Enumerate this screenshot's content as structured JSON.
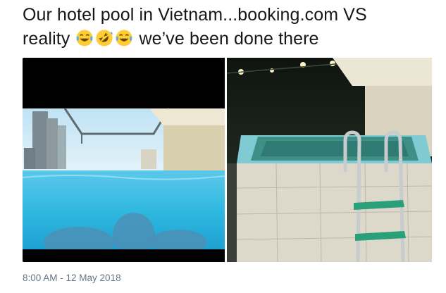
{
  "tweet": {
    "text_line1": "Our hotel pool in Vietnam...booking.com VS",
    "text_line2_before": "reality",
    "text_line2_after": "we’ve been done there",
    "emojis": [
      "face-with-tears-of-joy",
      "rolling-on-the-floor-laughing",
      "face-with-tears-of-joy"
    ],
    "timestamp": "8:00 AM - 12 May 2018"
  },
  "media": {
    "left_image": "infinity-pool-rooftop-photo",
    "right_image": "small-tiled-tub-pool-photo"
  },
  "colors": {
    "text": "#14171a",
    "meta": "#657786",
    "pool_blue": "#2fb8e0",
    "tile": "#d9d6c9"
  }
}
